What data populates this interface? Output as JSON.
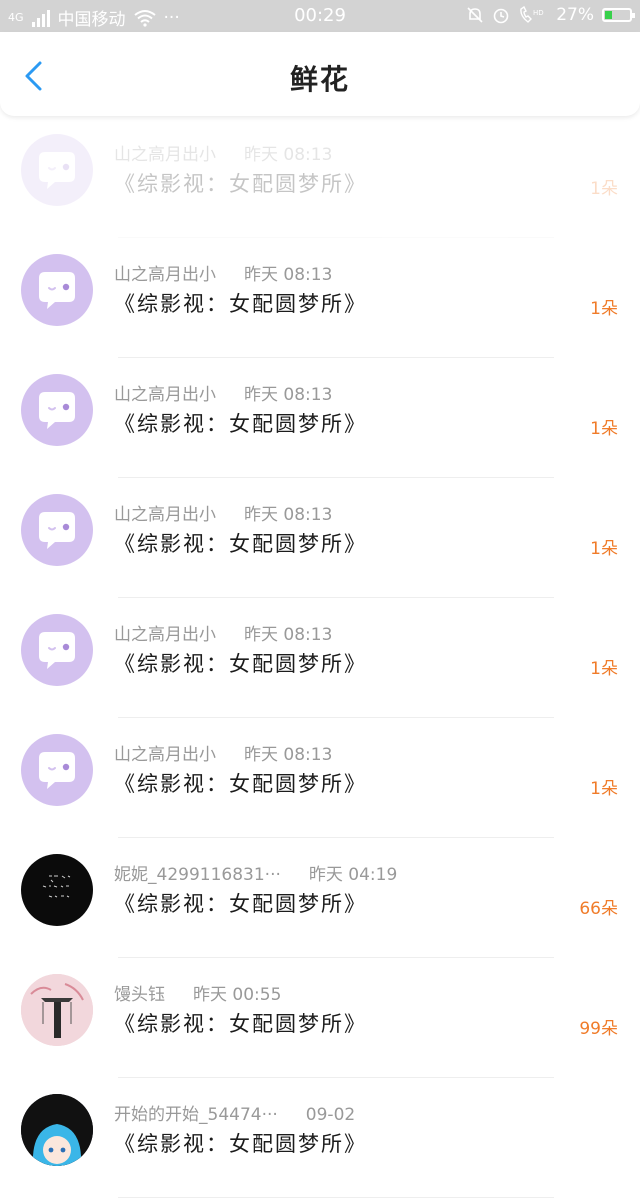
{
  "status_bar": {
    "network": "4G",
    "carrier": "中国移动",
    "more": "···",
    "time": "00:29",
    "battery_percent": "27%",
    "battery_level": 0.27,
    "icons": [
      "signal-icon",
      "wifi-icon",
      "mute-icon",
      "alarm-icon",
      "hd-call-icon",
      "battery-icon"
    ]
  },
  "header": {
    "title": "鲜花",
    "back_icon": "chevron-left-icon",
    "accent": "#2b9af3"
  },
  "items": [
    {
      "user": "山之高月出小",
      "time": "昨天 08:13",
      "book": "《综影视：女配圆梦所》",
      "count": "1朵",
      "avatar": "purple"
    },
    {
      "user": "山之高月出小",
      "time": "昨天 08:13",
      "book": "《综影视：女配圆梦所》",
      "count": "1朵",
      "avatar": "purple"
    },
    {
      "user": "山之高月出小",
      "time": "昨天 08:13",
      "book": "《综影视：女配圆梦所》",
      "count": "1朵",
      "avatar": "purple"
    },
    {
      "user": "山之高月出小",
      "time": "昨天 08:13",
      "book": "《综影视：女配圆梦所》",
      "count": "1朵",
      "avatar": "purple"
    },
    {
      "user": "山之高月出小",
      "time": "昨天 08:13",
      "book": "《综影视：女配圆梦所》",
      "count": "1朵",
      "avatar": "purple"
    },
    {
      "user": "山之高月出小",
      "time": "昨天 08:13",
      "book": "《综影视：女配圆梦所》",
      "count": "1朵",
      "avatar": "purple"
    },
    {
      "user": "妮妮_4299116831···",
      "time": "昨天 04:19",
      "book": "《综影视：女配圆梦所》",
      "count": "66朵",
      "avatar": "black"
    },
    {
      "user": "馒头钰",
      "time": "昨天 00:55",
      "book": "《综影视：女配圆梦所》",
      "count": "99朵",
      "avatar": "pink"
    },
    {
      "user": "开始的开始_54474···",
      "time": "09-02",
      "book": "《综影视：女配圆梦所》",
      "count": "",
      "avatar": "anime"
    }
  ],
  "colors": {
    "count_orange": "#f07c2a",
    "avatar_purple": "#d3c1ef",
    "status_bar_bg": "#d3d3d3"
  }
}
